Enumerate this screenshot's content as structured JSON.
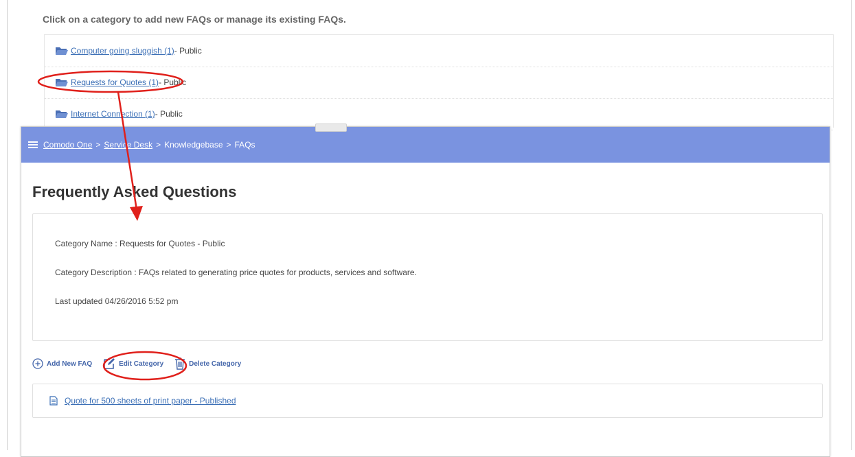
{
  "intro_text": "Click on a category to add new FAQs or manage its existing FAQs.",
  "categories": [
    {
      "label": "Computer going sluggish (1)",
      "visibility": " - Public"
    },
    {
      "label": "Requests for Quotes (1)",
      "visibility": " - Public"
    },
    {
      "label": "Internet Connection (1)",
      "visibility": " - Public"
    }
  ],
  "breadcrumb": {
    "items": [
      "Comodo One",
      "Service Desk",
      "Knowledgebase",
      "FAQs"
    ],
    "separator": ">"
  },
  "page_title": "Frequently Asked Questions",
  "details": {
    "name": "Category Name : Requests for Quotes - Public",
    "description": "Category Description : FAQs related to generating price quotes for products, services and software.",
    "updated": "Last updated 04/26/2016 5:52 pm"
  },
  "actions": {
    "add": "Add New FAQ",
    "edit": "Edit Category",
    "delete": "Delete Category"
  },
  "faq_item": "Quote for 500 sheets of print paper - Published",
  "colors": {
    "topbar": "#7a93e0",
    "link": "#3b6fb6",
    "annotation": "#e0201b"
  },
  "icons": {
    "folder": "folder-open-icon",
    "menu": "hamburger-menu-icon",
    "add": "plus-circle-icon",
    "edit": "edit-pencil-icon",
    "delete": "trash-icon",
    "document": "document-icon"
  }
}
